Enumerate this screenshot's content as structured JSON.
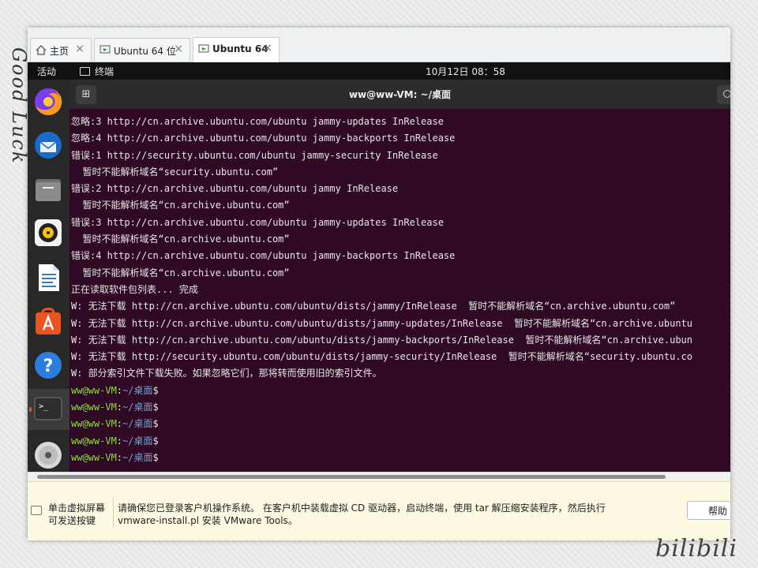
{
  "tabs": [
    {
      "label": "主页",
      "icon": "home-icon"
    },
    {
      "label": "Ubuntu 64 位",
      "icon": "vm-icon"
    },
    {
      "label": "Ubuntu 64",
      "icon": "vm-icon"
    }
  ],
  "topbar": {
    "activities": "活动",
    "app": "终端",
    "clock": "10月12日 08：58"
  },
  "dock": [
    "firefox-icon",
    "thunderbird-icon",
    "files-icon",
    "rhythmbox-icon",
    "writer-icon",
    "software-icon",
    "help-icon",
    "terminal-icon",
    "dvd-icon"
  ],
  "terminal": {
    "title": "ww@ww-VM: ~/桌面",
    "lines": [
      "忽略:3 http://cn.archive.ubuntu.com/ubuntu jammy-updates InRelease",
      "忽略:4 http://cn.archive.ubuntu.com/ubuntu jammy-backports InRelease",
      "错误:1 http://security.ubuntu.com/ubuntu jammy-security InRelease",
      "  暂时不能解析域名“security.ubuntu.com”",
      "错误:2 http://cn.archive.ubuntu.com/ubuntu jammy InRelease",
      "  暂时不能解析域名“cn.archive.ubuntu.com”",
      "错误:3 http://cn.archive.ubuntu.com/ubuntu jammy-updates InRelease",
      "  暂时不能解析域名“cn.archive.ubuntu.com”",
      "错误:4 http://cn.archive.ubuntu.com/ubuntu jammy-backports InRelease",
      "  暂时不能解析域名“cn.archive.ubuntu.com”",
      "正在读取软件包列表... 完成",
      "W: 无法下载 http://cn.archive.ubuntu.com/ubuntu/dists/jammy/InRelease  暂时不能解析域名“cn.archive.ubuntu.com”",
      "W: 无法下载 http://cn.archive.ubuntu.com/ubuntu/dists/jammy-updates/InRelease  暂时不能解析域名“cn.archive.ubuntu",
      "W: 无法下载 http://cn.archive.ubuntu.com/ubuntu/dists/jammy-backports/InRelease  暂时不能解析域名“cn.archive.ubun",
      "W: 无法下载 http://security.ubuntu.com/ubuntu/dists/jammy-security/InRelease  暂时不能解析域名“security.ubuntu.co",
      "W: 部分索引文件下载失败。如果忽略它们，那将转而使用旧的索引文件。"
    ],
    "prompt": {
      "user": "ww@ww-VM",
      "sep": ":",
      "path": "~/桌面",
      "sym": "$"
    },
    "prompt_count": 5
  },
  "hint": {
    "left1": "单击虚拟屏幕",
    "left2": "可发送按键",
    "right1": "请确保您已登录客户机操作系统。 在客户机中装载虚拟 CD 驱动器，启动终端，使用 tar 解压缩安装程序，然后执行",
    "right2": "vmware-install.pl 安装 VMware Tools。",
    "help": "帮助"
  },
  "watermark": {
    "left": "Good Luck",
    "right": "bilibili"
  }
}
